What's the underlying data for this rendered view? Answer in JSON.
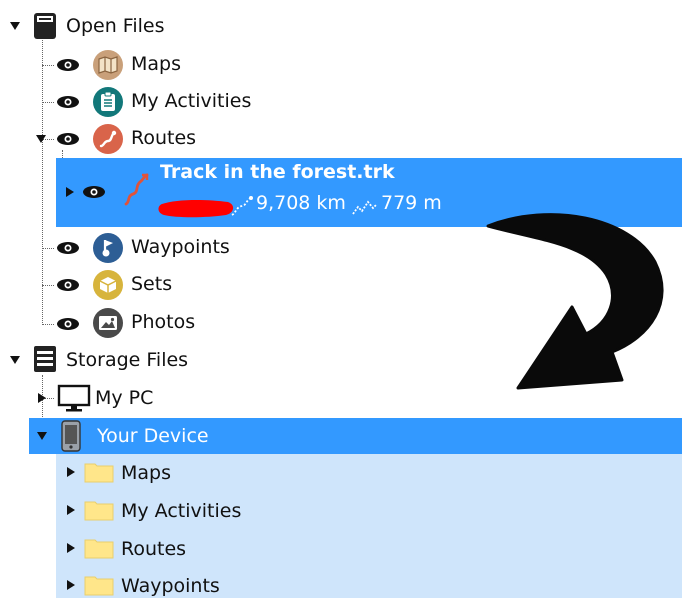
{
  "tree": {
    "open_files": {
      "label": "Open Files",
      "items": [
        {
          "label": "Maps",
          "icon": "map-icon",
          "color": "#c9a07a"
        },
        {
          "label": "My Activities",
          "icon": "clipboard-icon",
          "color": "#12787a"
        },
        {
          "label": "Routes",
          "icon": "route-icon",
          "color": "#d9644a"
        },
        {
          "label": "Waypoints",
          "icon": "waypoint-flag-icon",
          "color": "#2d5e95"
        },
        {
          "label": "Sets",
          "icon": "box-icon",
          "color": "#d7b43c"
        },
        {
          "label": "Photos",
          "icon": "photo-icon",
          "color": "#4a4a4a"
        }
      ],
      "track": {
        "name": "Track in the forest.trk",
        "distance": "9,708 km",
        "elevation": "779 m"
      }
    },
    "storage_files": {
      "label": "Storage Files",
      "my_pc": "My PC",
      "device": {
        "label": "Your Device",
        "folders": [
          "Maps",
          "My Activities",
          "Routes",
          "Waypoints"
        ]
      }
    }
  },
  "colors": {
    "selection": "#3399ff",
    "selection_light": "#cfe5fb",
    "folder": "#ffe68a",
    "redaction": "#ff0000"
  }
}
